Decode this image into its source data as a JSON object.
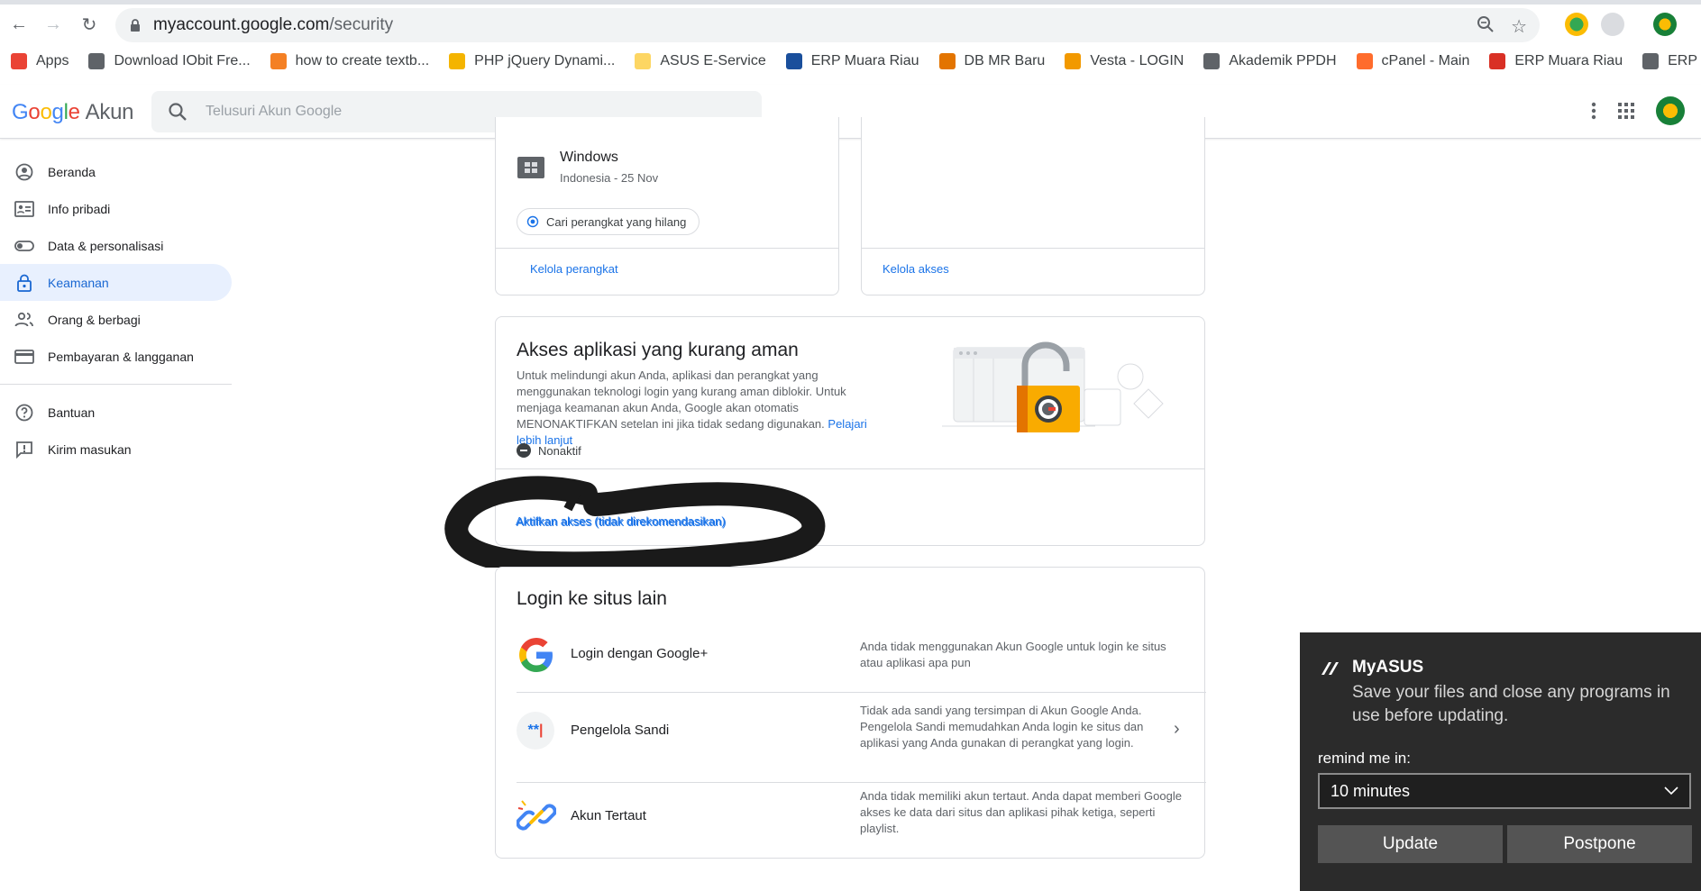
{
  "browser": {
    "url_host": "myaccount.google.com",
    "url_path": "/security",
    "bookmarks": [
      {
        "label": "Apps",
        "color": "#ea4335"
      },
      {
        "label": "Download IObit Fre...",
        "color": "#5f6368"
      },
      {
        "label": "how to create textb...",
        "color": "#f48024"
      },
      {
        "label": "PHP jQuery Dynami...",
        "color": "#f4b400"
      },
      {
        "label": "ASUS E-Service",
        "color": "#fdd663"
      },
      {
        "label": "ERP Muara Riau",
        "color": "#1a4f9c"
      },
      {
        "label": "DB MR Baru",
        "color": "#e37400"
      },
      {
        "label": "Vesta - LOGIN",
        "color": "#f29900"
      },
      {
        "label": "Akademik PPDH",
        "color": "#5f6368"
      },
      {
        "label": "cPanel - Main",
        "color": "#ff6c2c"
      },
      {
        "label": "ERP Muara Riau",
        "color": "#d93025"
      },
      {
        "label": "ERP Muara Riau",
        "color": "#5f6368"
      }
    ],
    "more": "»"
  },
  "header": {
    "logo_google": "Google",
    "logo_akun": "Akun",
    "search_placeholder": "Telusuri Akun Google"
  },
  "sidebar": {
    "items": [
      {
        "label": "Beranda",
        "icon": "account-circle-icon"
      },
      {
        "label": "Info pribadi",
        "icon": "id-card-icon"
      },
      {
        "label": "Data & personalisasi",
        "icon": "toggle-icon"
      },
      {
        "label": "Keamanan",
        "icon": "lock-icon"
      },
      {
        "label": "Orang & berbagi",
        "icon": "people-icon"
      },
      {
        "label": "Pembayaran & langganan",
        "icon": "credit-card-icon"
      }
    ],
    "secondary": [
      {
        "label": "Bantuan",
        "icon": "help-icon"
      },
      {
        "label": "Kirim masukan",
        "icon": "feedback-icon"
      }
    ]
  },
  "devices": {
    "device_name": "Windows",
    "device_meta": "Indonesia - 25 Nov",
    "find_device": "Cari perangkat yang hilang",
    "manage_devices": "Kelola perangkat",
    "manage_access": "Kelola akses"
  },
  "less_secure": {
    "title": "Akses aplikasi yang kurang aman",
    "body": "Untuk melindungi akun Anda, aplikasi dan perangkat yang menggunakan teknologi login yang kurang aman diblokir. Untuk menjaga keamanan akun Anda, Google akan otomatis MENONAKTIFKAN setelan ini jika tidak sedang digunakan.",
    "learn_more": "Pelajari lebih lanjut",
    "status": "Nonaktif",
    "enable_link": "Aktifkan akses (tidak direkomendasikan)"
  },
  "signin_other": {
    "title": "Login ke situs lain",
    "rows": [
      {
        "label": "Login dengan Google+",
        "desc": "Anda tidak menggunakan Akun Google untuk login ke situs atau aplikasi apa pun"
      },
      {
        "label": "Pengelola Sandi",
        "desc": "Tidak ada sandi yang tersimpan di Akun Google Anda. Pengelola Sandi memudahkan Anda login ke situs dan aplikasi yang Anda gunakan di perangkat yang login."
      },
      {
        "label": "Akun Tertaut",
        "desc": "Anda tidak memiliki akun tertaut. Anda dapat memberi Google akses ke data dari situs dan aplikasi pihak ketiga, seperti playlist."
      }
    ]
  },
  "toast": {
    "app": "MyASUS",
    "message": "Save your files and close any programs in use before updating.",
    "remind_label": "remind me in:",
    "remind_value": "10 minutes",
    "update": "Update",
    "postpone": "Postpone"
  }
}
